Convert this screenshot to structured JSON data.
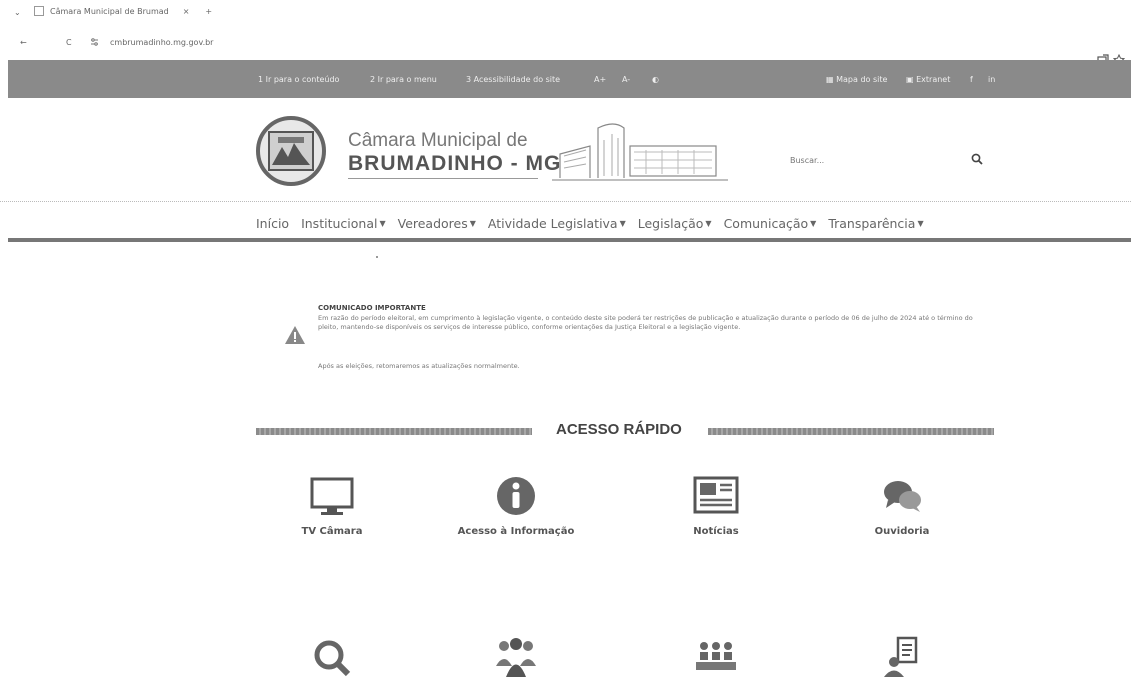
{
  "browser": {
    "tab_title": "Câmara Municipal de Brumad",
    "tab_close": "×",
    "tab_new": "+",
    "tab_chevron": "⌄",
    "back": "←",
    "reload": "C",
    "url": "cmbrumadinho.mg.gov.br"
  },
  "utility": {
    "items": [
      "1 Ir para o conteúdo",
      "2 Ir para o menu",
      "3 Acessibilidade do site",
      "A+",
      "A-",
      "◐",
      "Mapa do site",
      "Extranet",
      "f",
      "in"
    ]
  },
  "header": {
    "brand_line1": "Câmara Municipal de",
    "brand_line2": "BRUMADINHO - MG",
    "search_placeholder": "Buscar..."
  },
  "nav": {
    "items": [
      {
        "label": "Início",
        "dropdown": false
      },
      {
        "label": "Institucional",
        "dropdown": true
      },
      {
        "label": "Vereadores",
        "dropdown": true
      },
      {
        "label": "Atividade Legislativa",
        "dropdown": true
      },
      {
        "label": "Legislação",
        "dropdown": true
      },
      {
        "label": "Comunicação",
        "dropdown": true
      },
      {
        "label": "Transparência",
        "dropdown": true
      }
    ]
  },
  "notice": {
    "title": "COMUNICADO IMPORTANTE",
    "body": "Em razão do período eleitoral, em cumprimento à legislação vigente, o conteúdo deste site poderá ter restrições de publicação e atualização durante o período de 06 de julho de 2024 até o término do pleito, mantendo-se disponíveis os serviços de interesse público, conforme orientações da Justiça Eleitoral e a legislação vigente.",
    "foot": "Após as eleições, retomaremos as atualizações normalmente."
  },
  "quick_access": {
    "title": "ACESSO RÁPIDO",
    "items": [
      {
        "label": "TV Câmara",
        "icon": "monitor-icon"
      },
      {
        "label": "Acesso à Informação",
        "icon": "info-icon"
      },
      {
        "label": "Notícias",
        "icon": "newspaper-icon"
      },
      {
        "label": "Ouvidoria",
        "icon": "chat-bubbles-icon"
      },
      {
        "label": "",
        "icon": "magnifier-icon"
      },
      {
        "label": "",
        "icon": "group-icon"
      },
      {
        "label": "",
        "icon": "plenary-icon"
      },
      {
        "label": "",
        "icon": "document-person-icon"
      }
    ]
  }
}
